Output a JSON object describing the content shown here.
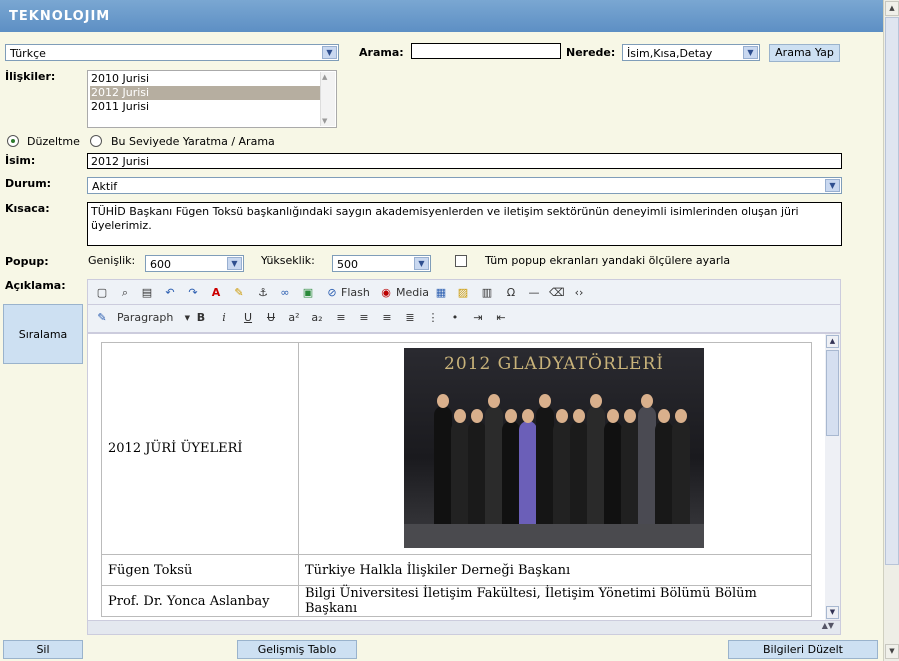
{
  "header": {
    "logo": "TEKNOLOJIM"
  },
  "top": {
    "language": "Türkçe",
    "search_label": "Arama:",
    "search_value": "",
    "where_label": "Nerede:",
    "where_value": "İsim,Kısa,Detay",
    "search_button": "Arama Yap"
  },
  "relations": {
    "label": "İlişkiler:",
    "items": [
      "2010 Jurisi",
      "2012 Jurisi",
      "2011 Jurisi"
    ],
    "selected": "2012 Jurisi"
  },
  "mode": {
    "edit_label": "Düzeltme",
    "create_label": "Bu Seviyede Yaratma / Arama",
    "selected": "edit"
  },
  "form": {
    "name_label": "İsim:",
    "name_value": "2012 Jurisi",
    "status_label": "Durum:",
    "status_value": "Aktif",
    "short_label": "Kısaca:",
    "short_value": "TÜHİD Başkanı Fügen Toksü başkanlığındaki saygın akademisyenlerden ve iletişim sektörünün deneyimli isimlerinden oluşan jüri üyelerimiz.",
    "popup_label": "Popup:",
    "width_label": "Genişlik:",
    "width_value": "600",
    "height_label": "Yükseklik:",
    "height_value": "500",
    "popup_all_label": "Tüm popup ekranları yandaki ölçülere ayarla",
    "popup_all_checked": false,
    "description_label": "Açıklama:"
  },
  "editor": {
    "flash_label": "Flash",
    "media_label": "Media",
    "format_value": "Paragraph",
    "bold": "B",
    "italic": "i",
    "underline": "U",
    "strike": "U",
    "superscript": "a²",
    "subscript": "a₂",
    "table": {
      "header_left": "2012 JÜRİ ÜYELERİ",
      "photo_title": "2012 GLADYATÖRLERİ",
      "rows": [
        {
          "name": "Fügen Toksü",
          "title": "Türkiye Halkla İlişkiler Derneği Başkanı"
        },
        {
          "name": "Prof. Dr. Yonca Aslanbay",
          "title": "Bilgi Üniversitesi İletişim Fakültesi, İletişim Yönetimi Bölümü Bölüm Başkanı"
        }
      ]
    }
  },
  "side": {
    "sort_button": "Sıralama"
  },
  "bottom": {
    "delete_button": "Sil",
    "advanced_table_button": "Gelişmiş Tablo",
    "update_button": "Bilgileri Düzelt"
  }
}
